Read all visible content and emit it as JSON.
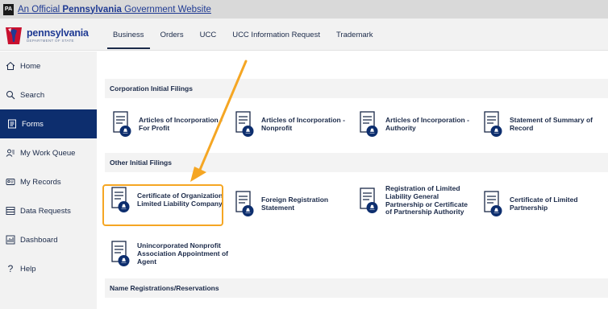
{
  "banner": {
    "badge": "PA",
    "text_prefix": "An Official ",
    "text_bold": "Pennsylvania",
    "text_suffix": " Government Website"
  },
  "logo": {
    "name": "pennsylvania",
    "subtitle": "DEPARTMENT OF STATE"
  },
  "tabs": [
    {
      "label": "Business",
      "active": true
    },
    {
      "label": "Orders"
    },
    {
      "label": "UCC"
    },
    {
      "label": "UCC Information Request"
    },
    {
      "label": "Trademark"
    }
  ],
  "sidebar": {
    "items": [
      {
        "label": "Home",
        "icon": "home-icon"
      },
      {
        "label": "Search",
        "icon": "search-icon"
      },
      {
        "label": "Forms",
        "icon": "forms-icon",
        "active": true
      },
      {
        "label": "My Work Queue",
        "icon": "work-queue-icon"
      },
      {
        "label": "My Records",
        "icon": "records-icon"
      },
      {
        "label": "Data Requests",
        "icon": "data-requests-icon"
      },
      {
        "label": "Dashboard",
        "icon": "dashboard-icon"
      },
      {
        "label": "Help",
        "icon": "help-icon"
      }
    ]
  },
  "sections": {
    "corporation": {
      "title": "Corporation Initial Filings",
      "cards": [
        {
          "label": "Articles of Incorporation - For Profit"
        },
        {
          "label": "Articles of Incorporation - Nonprofit"
        },
        {
          "label": "Articles of Incorporation - Authority"
        },
        {
          "label": "Statement of Summary of Record"
        }
      ]
    },
    "other": {
      "title": "Other Initial Filings",
      "cards": [
        {
          "label": "Certificate of Organization Limited Liability Company",
          "highlighted": true
        },
        {
          "label": "Foreign Registration Statement"
        },
        {
          "label": "Registration of Limited Liability General Partnership or Certificate of Partnership Authority"
        },
        {
          "label": "Certificate of Limited Partnership"
        },
        {
          "label": "Unincorporated Nonprofit Association Appointment of Agent"
        }
      ]
    },
    "names": {
      "title": "Name Registrations/Reservations"
    }
  },
  "colors": {
    "navy": "#0d2e6e",
    "text": "#1b2a49",
    "highlight": "#f5a623",
    "keystone_red": "#c8102e"
  }
}
